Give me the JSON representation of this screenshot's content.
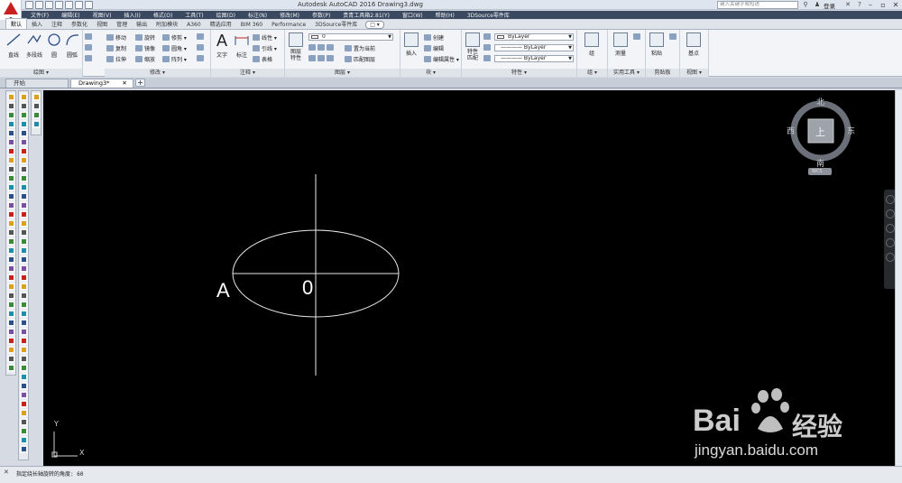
{
  "titlebar": {
    "title": "Autodesk AutoCAD 2016    Drawing3.dwg",
    "search_placeholder": "键入关键字或短语",
    "login": "登录"
  },
  "menubar": [
    "文件(F)",
    "编辑(E)",
    "视图(V)",
    "插入(I)",
    "格式(O)",
    "工具(T)",
    "绘图(D)",
    "标注(N)",
    "修改(M)",
    "参数(P)",
    "贵青工具箱2.81(Y)",
    "窗口(W)",
    "帮助(H)",
    "3DSource零件库"
  ],
  "ribbon_tabs": [
    "默认",
    "插入",
    "注释",
    "参数化",
    "视图",
    "管理",
    "输出",
    "附加模块",
    "A360",
    "精选应用",
    "BIM 360",
    "Performance",
    "3DSource零件库"
  ],
  "ribbon_tab_pill": "□ ▾",
  "panels": {
    "draw": {
      "title": "绘图 ▾",
      "line": "直线",
      "polyline": "多段线",
      "circle": "圆",
      "arc": "圆弧"
    },
    "modify": {
      "title": "修改 ▾",
      "move": "移动",
      "rotate": "旋转",
      "trim": "修剪 ▾",
      "copy": "复制",
      "mirror": "镜像",
      "fillet": "圆角 ▾",
      "stretch": "拉伸",
      "scale": "缩放",
      "array": "阵列 ▾"
    },
    "annotation": {
      "title": "注释 ▾",
      "text": "文字",
      "dimension": "标注",
      "linear": "线性 ▾",
      "leader": "引线 ▾",
      "table": "表格"
    },
    "layers": {
      "title": "图层 ▾",
      "layer_props": "图层\n特性",
      "layer_value": "0",
      "set_current": "置为当前",
      "match_layer": "匹配图层"
    },
    "block": {
      "title": "块 ▾",
      "insert": "插入",
      "create": "创建",
      "edit": "编辑",
      "edit_attr": "编辑属性 ▾"
    },
    "properties": {
      "title": "特性 ▾",
      "match": "特性\n匹配",
      "color": "ByLayer",
      "linetype": "———— ByLayer",
      "lineweight": "———— ByLayer"
    },
    "groups": {
      "title": "组 ▾",
      "group": "组"
    },
    "utilities": {
      "title": "实用工具 ▾",
      "measure": "测量"
    },
    "clipboard": {
      "title": "剪贴板",
      "paste": "粘贴"
    },
    "view": {
      "title": "视图 ▾",
      "base": "基点"
    }
  },
  "file_tabs": [
    {
      "label": "开始"
    },
    {
      "label": "Drawing3*"
    }
  ],
  "drawing": {
    "label_a": "A",
    "label_o": "0"
  },
  "viewcube": {
    "north": "北",
    "south": "南",
    "east": "东",
    "west": "西",
    "top": "上",
    "wcs": "WCS"
  },
  "ucs": {
    "x": "X",
    "y": "Y"
  },
  "command": {
    "prompt": "指定绕长轴旋转的角度: 60"
  },
  "watermark": {
    "brand_a": "Bai",
    "brand_b": "经验",
    "url": "jingyan.baidu.com"
  }
}
